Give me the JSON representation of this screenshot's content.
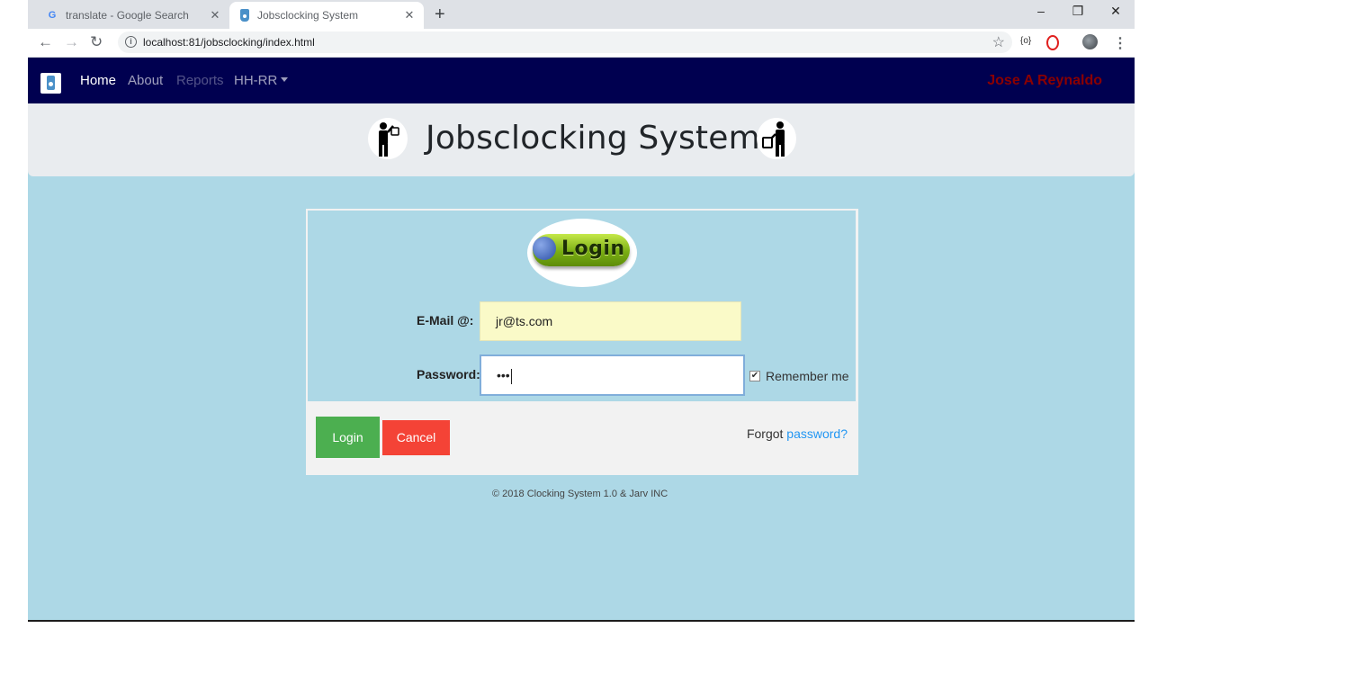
{
  "browser": {
    "tabs": [
      {
        "title": "translate - Google Search",
        "active": false
      },
      {
        "title": "Jobsclocking System",
        "active": true
      }
    ],
    "url": "localhost:81/jobsclocking/index.html",
    "new_tab": "+",
    "close_glyph": "✕",
    "window_controls": {
      "minimize": "–",
      "restore": "❐",
      "close": "✕"
    },
    "nav": {
      "back": "←",
      "forward": "→",
      "reload": "↻"
    },
    "bookmark_star": "☆",
    "ext_label": "{o}",
    "menu": "⋮",
    "info_glyph": "i"
  },
  "navbar": {
    "links": {
      "home": "Home",
      "about": "About",
      "reports": "Reports",
      "hhrr": "HH-RR"
    },
    "user": "Jose A Reynaldo",
    "colors": {
      "bg": "#000050",
      "user": "#8b0000"
    }
  },
  "header": {
    "title": "Jobsclocking System!"
  },
  "login": {
    "badge_text": "Login",
    "email_label": "E-Mail @:",
    "email_value": "jr@ts.com",
    "password_label": "Password:",
    "password_value": "•••",
    "remember_label": "Remember me",
    "remember_checked": true,
    "login_button": "Login",
    "cancel_button": "Cancel",
    "forgot_prefix": "Forgot ",
    "forgot_link": "password?",
    "colors": {
      "page_bg": "#add8e6",
      "login_btn": "#4caf50",
      "cancel_btn": "#f44336"
    }
  },
  "footer": {
    "text": "© 2018 Clocking System 1.0 & Jarv INC"
  }
}
